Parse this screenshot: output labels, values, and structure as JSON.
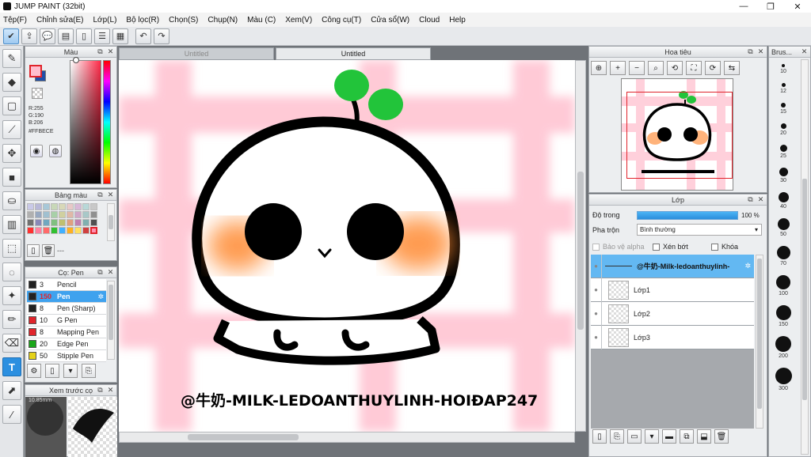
{
  "window": {
    "title": "JUMP PAINT (32bit)",
    "min": "—",
    "max": "❐",
    "close": "✕"
  },
  "menu": [
    "Tệp(F)",
    "Chỉnh sửa(E)",
    "Lớp(L)",
    "Bộ lọc(R)",
    "Chọn(S)",
    "Chụp(N)",
    "Màu (C)",
    "Xem(V)",
    "Công cụ(T)",
    "Cửa sổ(W)",
    "Cloud",
    "Help"
  ],
  "tabs": [
    {
      "label": "Untitled",
      "active": false
    },
    {
      "label": "Untitled",
      "active": true
    }
  ],
  "color_panel": {
    "title": "Màu",
    "r": "R:255",
    "g": "G:190",
    "b": "B:206",
    "hex": "#FFBECE",
    "fg": "#ffbece",
    "bg": "#1f4ea8"
  },
  "palette_panel": {
    "title": "Bảng màu",
    "footer_text": "---"
  },
  "brush_panel": {
    "title": "Cọ: Pen",
    "items": [
      {
        "size": "3",
        "name": "Pencil",
        "color": "#222222"
      },
      {
        "size": "150",
        "name": "Pen",
        "color": "#222222",
        "selected": true
      },
      {
        "size": "8",
        "name": "Pen (Sharp)",
        "color": "#222222"
      },
      {
        "size": "10",
        "name": "G Pen",
        "color": "#e0242b"
      },
      {
        "size": "8",
        "name": "Mapping Pen",
        "color": "#e0242b"
      },
      {
        "size": "20",
        "name": "Edge Pen",
        "color": "#1aa61a"
      },
      {
        "size": "50",
        "name": "Stipple Pen",
        "color": "#e5d21a"
      }
    ]
  },
  "preview_panel": {
    "title": "Xem trước cọ",
    "size_label": "10.85mm"
  },
  "canvas": {
    "signature": "@牛奶-MILK-LEDOANTHUYLINH-HOIĐAP247"
  },
  "navigator": {
    "title": "Hoa tiêu"
  },
  "layer_panel": {
    "title": "Lớp",
    "opacity_label": "Độ trong",
    "opacity_value": "100 %",
    "opacity_fraction": 1.0,
    "blend_label": "Pha trộn",
    "blend_value": "Bình thường",
    "protect_alpha": "Bảo vệ alpha",
    "clipping": "Xén bớt",
    "lock": "Khóa",
    "layers": [
      {
        "name": "@牛奶-Milk-ledoanthuylinh-",
        "selected": true
      },
      {
        "name": "Lớp1",
        "selected": false
      },
      {
        "name": "Lớp2",
        "selected": false
      },
      {
        "name": "Lớp3",
        "selected": false
      }
    ]
  },
  "size_panel": {
    "title": "Brus...",
    "sizes": [
      "10",
      "12",
      "15",
      "20",
      "25",
      "30",
      "40",
      "50",
      "70",
      "100",
      "150",
      "200",
      "300"
    ]
  }
}
